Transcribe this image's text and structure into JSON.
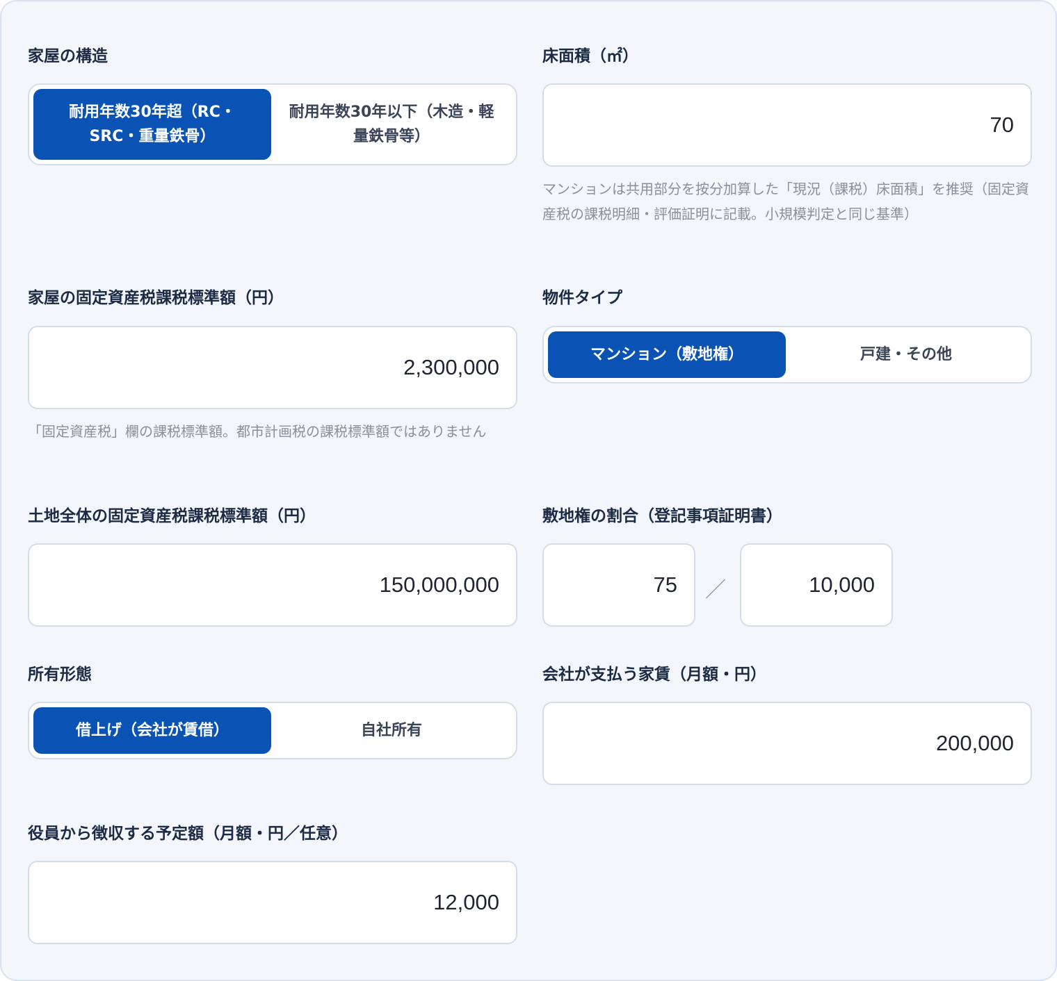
{
  "structure": {
    "label": "家屋の構造",
    "options": [
      {
        "line1": "耐用年数30年超（RC・",
        "line2": "SRC・重量鉄骨）",
        "selected": true
      },
      {
        "line1": "耐用年数30年以下（木造・軽",
        "line2": "量鉄骨等）",
        "selected": false
      }
    ]
  },
  "floor_area": {
    "label": "床面積（㎡）",
    "value": "70",
    "hint": "マンションは共用部分を按分加算した「現況（課税）床面積」を推奨（固定資産税の課税明細・評価証明に記載。小規模判定と同じ基準）"
  },
  "house_tax_base": {
    "label": "家屋の固定資産税課税標準額（円）",
    "value": "2,300,000",
    "hint": "「固定資産税」欄の課税標準額。都市計画税の課税標準額ではありません"
  },
  "property_type": {
    "label": "物件タイプ",
    "options": [
      {
        "label": "マンション（敷地権）",
        "selected": true
      },
      {
        "label": "戸建・その他",
        "selected": false
      }
    ]
  },
  "land_tax_base": {
    "label": "土地全体の固定資産税課税標準額（円）",
    "value": "150,000,000"
  },
  "site_right_ratio": {
    "label": "敷地権の割合（登記事項証明書）",
    "numerator": "75",
    "separator": "／",
    "denominator": "10,000"
  },
  "ownership": {
    "label": "所有形態",
    "options": [
      {
        "label": "借上げ（会社が賃借）",
        "selected": true
      },
      {
        "label": "自社所有",
        "selected": false
      }
    ]
  },
  "company_rent": {
    "label": "会社が支払う家賃（月額・円）",
    "value": "200,000"
  },
  "officer_collection": {
    "label": "役員から徴収する予定額（月額・円／任意）",
    "value": "12,000"
  },
  "colors": {
    "accent": "#0a53b5",
    "panel_bg": "#f3f7fc",
    "label_text": "#1c2a44",
    "hint_text": "#8a8f99"
  }
}
